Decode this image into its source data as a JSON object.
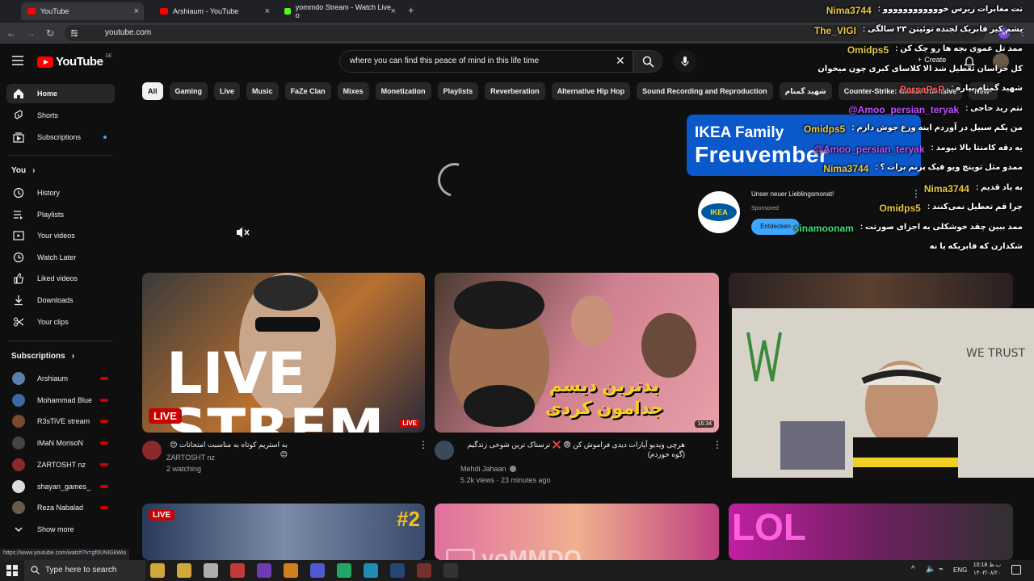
{
  "browser": {
    "tabs": [
      {
        "label": "YouTube",
        "color": "#ff0000"
      },
      {
        "label": "Arshiaum - YouTube",
        "color": "#ff0000"
      },
      {
        "label": "yommdo Stream - Watch Live o",
        "color": "#53fc18"
      }
    ],
    "url": "youtube.com"
  },
  "header": {
    "logo_text": "YouTube",
    "country": "DE",
    "search_value": "where you can find this peace of mind in this life time",
    "create_label": "Create"
  },
  "chips": [
    "All",
    "Gaming",
    "Live",
    "Music",
    "FaZe Clan",
    "Mixes",
    "Monetization",
    "Playlists",
    "Reverberation",
    "Alternative Hip Hop",
    "Sound Recording and Reproduction",
    "شهید گمنام",
    "Counter-Strike: Global Offensive",
    "New-"
  ],
  "sidebar": {
    "main": [
      {
        "label": "Home",
        "icon": "home-icon"
      },
      {
        "label": "Shorts",
        "icon": "shorts-icon"
      },
      {
        "label": "Subscriptions",
        "icon": "subscriptions-icon"
      }
    ],
    "you_heading": "You",
    "you_items": [
      {
        "label": "History",
        "icon": "history-icon"
      },
      {
        "label": "Playlists",
        "icon": "playlists-icon"
      },
      {
        "label": "Your videos",
        "icon": "your-videos-icon"
      },
      {
        "label": "Watch Later",
        "icon": "watch-later-icon"
      },
      {
        "label": "Liked videos",
        "icon": "like-icon"
      },
      {
        "label": "Downloads",
        "icon": "download-icon"
      },
      {
        "label": "Your clips",
        "icon": "scissors-icon"
      }
    ],
    "subs_heading": "Subscriptions",
    "subscriptions": [
      {
        "label": "Arshiaum",
        "color": "#5a7fa8"
      },
      {
        "label": "Mohammad Blue",
        "color": "#3a6aa0"
      },
      {
        "label": "R3sTiVE stream",
        "color": "#7a4a2a"
      },
      {
        "label": "iMaN MorisoN",
        "color": "#444"
      },
      {
        "label": "ZARTOSHT nz",
        "color": "#8a2a2a"
      },
      {
        "label": "shayan_games_",
        "color": "#ddd"
      },
      {
        "label": "Reza Nabalad",
        "color": "#6a5a4a"
      }
    ],
    "show_more": "Show more"
  },
  "ad": {
    "banner_line1": "IKEA Family",
    "banner_line2": "Freuvember",
    "logo_text": "IKEA",
    "headline": "Unser neuer Lieblingsmonat!",
    "sponsored": "Sponsored",
    "cta": "Entdecken"
  },
  "videos": [
    {
      "title": "به استریم کوتاه به مناسبت امتحانات 😊😊",
      "channel": "ZARTOSHT nz",
      "meta": "2 watching",
      "badge": "LIVE",
      "thumb_text": "LIVE STREM"
    },
    {
      "title": "هرچی ویدیو آپارات دیدی فراموش کن 😨 ❌ ترسناک ترین شوخی زندگیم (گوه خوردم)",
      "channel": "Mehdi Jahaan",
      "meta": "5.2k views · 23 minutes ago",
      "thumb_text": "بدترین دیسم جدامون کردی",
      "duration": "16:34"
    },
    {
      "title": "",
      "channel": "",
      "meta": ""
    }
  ],
  "row2": [
    {
      "badge": "LIVE",
      "thumb_text": "#2"
    },
    {
      "thumb_text": ""
    },
    {
      "thumb_text": "LOL"
    }
  ],
  "chat": [
    {
      "user": "Nima3744",
      "color": "#e8c848",
      "msg": ": نت مغابرات زیرس خوووووووووووو"
    },
    {
      "user": "The_VIGI",
      "color": "#e8c848",
      "msg": ": پشم کیر فابریک لجنده توئیتن ۲۳ سالگی"
    },
    {
      "user": "Omidps5",
      "color": "#e8c848",
      "msg": ": ممد تل عموی بچه ها رو چک کن"
    },
    {
      "user": "",
      "color": "#ffffff",
      "msg": "کل خراسان تعطیل شد الا کلاسای کبری چون میخوان"
    },
    {
      "user": "ParsaPsP",
      "color": "#ff6060",
      "msg": ": شهید گمنام بیاره"
    },
    {
      "user": "@Amoo_persian_teryak",
      "color": "#c050ff",
      "msg": ": نتم رید حاجی"
    },
    {
      "user": "Omidps5",
      "color": "#e8c848",
      "msg": ": من یکم سبیل در آوردم اینه وزغ جوش دارم"
    },
    {
      "user": "@Amoo_persian_teryak",
      "color": "#c050ff",
      "msg": ": یه دقه کامنتا بالا نیومد"
    },
    {
      "user": "Nima3744",
      "color": "#e8c848",
      "msg": ": ممدو مثل تویتچ ویو فیک بزنم برات ؟"
    },
    {
      "user": "Nima3744",
      "color": "#e8c848",
      "msg": ": به یاد قدیم"
    },
    {
      "user": "Omidps5",
      "color": "#e8c848",
      "msg": ": چرا قم تعطیل نمی‌کنند"
    },
    {
      "user": "sinamoonam",
      "color": "#40e080",
      "msg": ": ممد ببین چقد خوشکلی به اجزای صورتت"
    },
    {
      "user": "",
      "color": "#ffffff",
      "msg": "شکدارن که فابریکه یا نه"
    }
  ],
  "status_url": "https://www.youtube.com/watch?v=gf0UNIGkWio",
  "taskbar": {
    "search_placeholder": "Type here to search",
    "lang": "ENG",
    "time": "10:18 ب.ظ",
    "date": "۱۴۰۳/۰۸/۲۰"
  },
  "watermark": "yoMMDO"
}
